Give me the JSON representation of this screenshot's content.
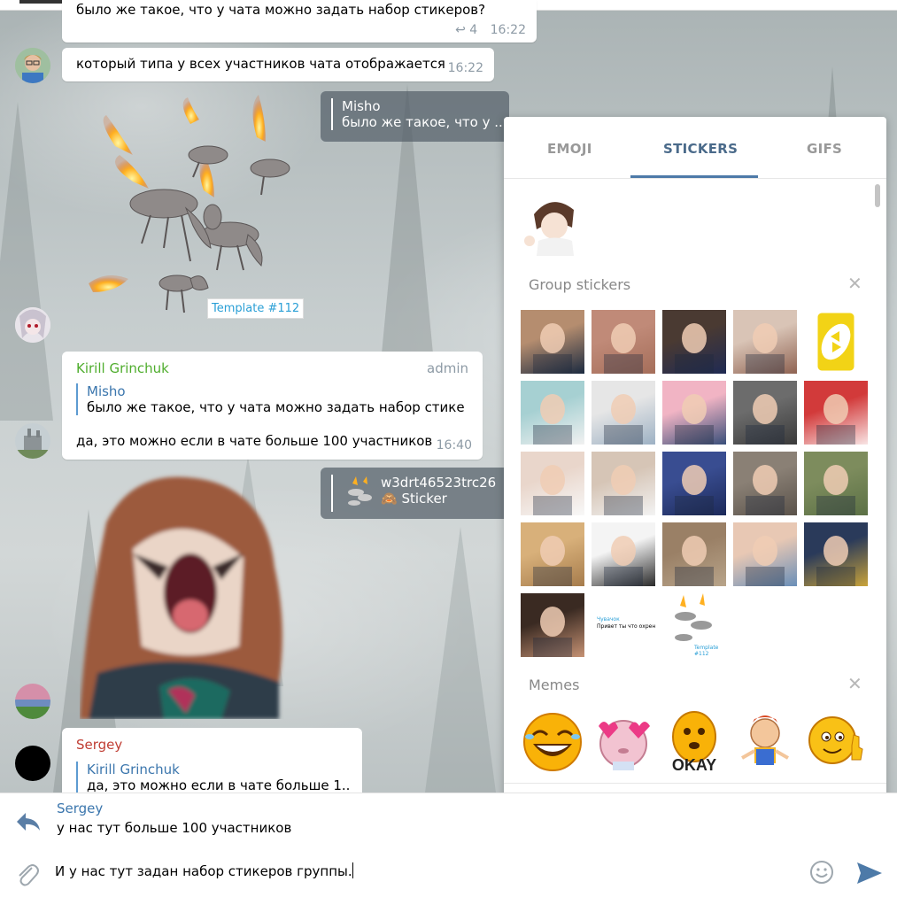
{
  "messages": {
    "m1_text": "было же такое, что у чата можно задать набор стикеров?",
    "m1_replies": "4",
    "m1_time": "16:22",
    "m2_text": "который типа у всех участников чата отображается",
    "m2_time": "16:22",
    "reply1_name": "Misho",
    "reply1_text": "было же такое, что у ...",
    "sticker_template_label": "Template #112",
    "m3_sender": "Kirill Grinchuk",
    "m3_badge": "admin",
    "m3_quote_name": "Misho",
    "m3_quote_text": "было же такое, что у чата можно задать набор стике...",
    "m3_text": "да, это можно если в чате больше 100 участников",
    "m3_time": "16:40",
    "reply2_name": "w3drt46523trc26",
    "reply2_text": "Sticker",
    "m4_sender": "Sergey",
    "m4_quote_name": "Kirill Grinchuk",
    "m4_quote_text": "да, это можно если в чате больше 1..."
  },
  "colors": {
    "kirill": "#4fad2d",
    "sergey": "#c03d33",
    "link": "#3b76ad",
    "accent": "#4d7aa8"
  },
  "panel": {
    "tabs": [
      "EMOJI",
      "STICKERS",
      "GIFS"
    ],
    "active_tab": "STICKERS",
    "section1": "Group stickers",
    "section2": "Memes",
    "mini_template_label": "Template #112",
    "mini_chat_line1": "Чувачок",
    "mini_chat_line2": "Привет ты что охренел"
  },
  "icons": [
    "search-icon",
    "add-sticker-icon",
    "recent-clock-icon",
    "settings-gear-icon",
    "reply-arrow-icon",
    "attach-paperclip-icon",
    "emoji-smile-icon",
    "send-arrow-icon",
    "close-icon"
  ],
  "compose": {
    "reply_sender": "Sergey",
    "reply_text": "у нас тут больше 100 участников",
    "input_value": "И у нас тут задан набор стикеров группы."
  }
}
